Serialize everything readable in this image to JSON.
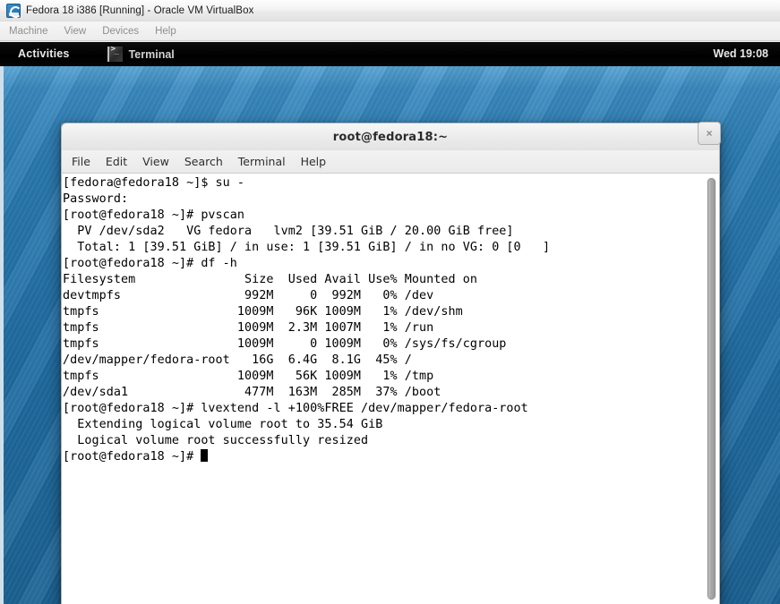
{
  "host_window": {
    "title": "Fedora 18 i386 [Running] - Oracle VM VirtualBox",
    "icon": "virtualbox-icon",
    "menu": [
      {
        "label": "Machine"
      },
      {
        "label": "View"
      },
      {
        "label": "Devices"
      },
      {
        "label": "Help"
      }
    ]
  },
  "desktop": {
    "topbar": {
      "activities_label": "Activities",
      "window_list": {
        "icon": "terminal-icon",
        "label": "Terminal"
      },
      "clock": "Wed 19:08"
    }
  },
  "terminal": {
    "title": "root@fedora18:~",
    "close_label": "×",
    "menu": [
      {
        "label": "File"
      },
      {
        "label": "Edit"
      },
      {
        "label": "View"
      },
      {
        "label": "Search"
      },
      {
        "label": "Terminal"
      },
      {
        "label": "Help"
      }
    ],
    "lines": [
      "[fedora@fedora18 ~]$ su -",
      "Password:",
      "[root@fedora18 ~]# pvscan",
      "  PV /dev/sda2   VG fedora   lvm2 [39.51 GiB / 20.00 GiB free]",
      "  Total: 1 [39.51 GiB] / in use: 1 [39.51 GiB] / in no VG: 0 [0   ]",
      "[root@fedora18 ~]# df -h",
      "Filesystem               Size  Used Avail Use% Mounted on",
      "devtmpfs                 992M     0  992M   0% /dev",
      "tmpfs                   1009M   96K 1009M   1% /dev/shm",
      "tmpfs                   1009M  2.3M 1007M   1% /run",
      "tmpfs                   1009M     0 1009M   0% /sys/fs/cgroup",
      "/dev/mapper/fedora-root   16G  6.4G  8.1G  45% /",
      "tmpfs                   1009M   56K 1009M   1% /tmp",
      "/dev/sda1                477M  163M  285M  37% /boot",
      "[root@fedora18 ~]# lvextend -l +100%FREE /dev/mapper/fedora-root",
      "  Extending logical volume root to 35.54 GiB",
      "  Logical volume root successfully resized",
      "[root@fedora18 ~]# "
    ],
    "df_table": {
      "headers": [
        "Filesystem",
        "Size",
        "Used",
        "Avail",
        "Use%",
        "Mounted on"
      ],
      "rows": [
        [
          "devtmpfs",
          "992M",
          "0",
          "992M",
          "0%",
          "/dev"
        ],
        [
          "tmpfs",
          "1009M",
          "96K",
          "1009M",
          "1%",
          "/dev/shm"
        ],
        [
          "tmpfs",
          "1009M",
          "2.3M",
          "1007M",
          "1%",
          "/run"
        ],
        [
          "tmpfs",
          "1009M",
          "0",
          "1009M",
          "0%",
          "/sys/fs/cgroup"
        ],
        [
          "/dev/mapper/fedora-root",
          "16G",
          "6.4G",
          "8.1G",
          "45%",
          "/"
        ],
        [
          "tmpfs",
          "1009M",
          "56K",
          "1009M",
          "1%",
          "/tmp"
        ],
        [
          "/dev/sda1",
          "477M",
          "163M",
          "285M",
          "37%",
          "/boot"
        ]
      ]
    },
    "cursor_visible": true
  },
  "colors": {
    "desktop_blue": "#2b7cb3",
    "topbar_black": "#000000",
    "terminal_bg": "#ffffff",
    "terminal_fg": "#000000",
    "chrome_gray": "#ececec"
  }
}
